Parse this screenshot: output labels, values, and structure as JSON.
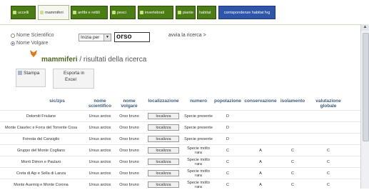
{
  "nav": {
    "tabs": [
      {
        "label": "uccelli"
      },
      {
        "label": "mammiferi"
      },
      {
        "label": "anfibi e rettili"
      },
      {
        "label": "pesci"
      },
      {
        "label": "invertebrati"
      },
      {
        "label": "piante"
      },
      {
        "label": "habitat"
      },
      {
        "label": "corrispondenze habitat fvg"
      }
    ]
  },
  "search": {
    "radio_scientific": "Nome Scientifico",
    "radio_common": "Nome Volgare",
    "select_value": "Inizia per",
    "query": "orso",
    "go_label": "avvia la ricerca >"
  },
  "results": {
    "title": "mammiferi",
    "subtitle": " / risultati della ricerca",
    "print_label": "Stampa",
    "export_label_1": "Esporta in",
    "export_label_2": "Excel"
  },
  "table": {
    "headers": {
      "site": "sic/zps",
      "sci_1": "nome",
      "sci_2": "scientifico",
      "com_1": "nome",
      "com_2": "volgare",
      "loc": "localizzazione",
      "num": "numero",
      "pop": "popolazione",
      "cons": "conservazione",
      "iso": "isolamento",
      "glob_1": "valutazione",
      "glob_2": "globale"
    },
    "rows": [
      {
        "site": "Dolomiti Friulane",
        "sci": "Ursus arctos",
        "com": "Orso bruno",
        "loc": "localizza",
        "num": "Specie presente",
        "pop": "D",
        "cons": "",
        "iso": "",
        "glob": ""
      },
      {
        "site": "Monte Ciaurlec e Forra del Torrente Cosa",
        "sci": "Ursus arctos",
        "com": "Orso bruno",
        "loc": "localizza",
        "num": "Specie presente",
        "pop": "D",
        "cons": "",
        "iso": "",
        "glob": ""
      },
      {
        "site": "Foresta del Cansiglio",
        "sci": "Ursus arctos",
        "com": "Orso bruno",
        "loc": "localizza",
        "num": "Specie presente",
        "pop": "D",
        "cons": "",
        "iso": "",
        "glob": ""
      },
      {
        "site": "Gruppo del Monte Coglians",
        "sci": "Ursus arctos",
        "com": "Orso bruno",
        "loc": "localizza",
        "num": "Specie molto rara",
        "pop": "C",
        "cons": "A",
        "iso": "C",
        "glob": "C"
      },
      {
        "site": "Monti Dimon e Paularo",
        "sci": "Ursus arctos",
        "com": "Orso bruno",
        "loc": "localizza",
        "num": "Specie molto rara",
        "pop": "C",
        "cons": "A",
        "iso": "C",
        "glob": "C"
      },
      {
        "site": "Creta di Aip e Sella di Lanza",
        "sci": "Ursus arctos",
        "com": "Orso bruno",
        "loc": "localizza",
        "num": "Specie molto rara",
        "pop": "C",
        "cons": "A",
        "iso": "C",
        "glob": "C"
      },
      {
        "site": "Monte Auernig e Monte Corona",
        "sci": "Ursus arctos",
        "com": "Orso bruno",
        "loc": "localizza",
        "num": "Specie molto rara",
        "pop": "C",
        "cons": "A",
        "iso": "C",
        "glob": "C"
      }
    ]
  }
}
